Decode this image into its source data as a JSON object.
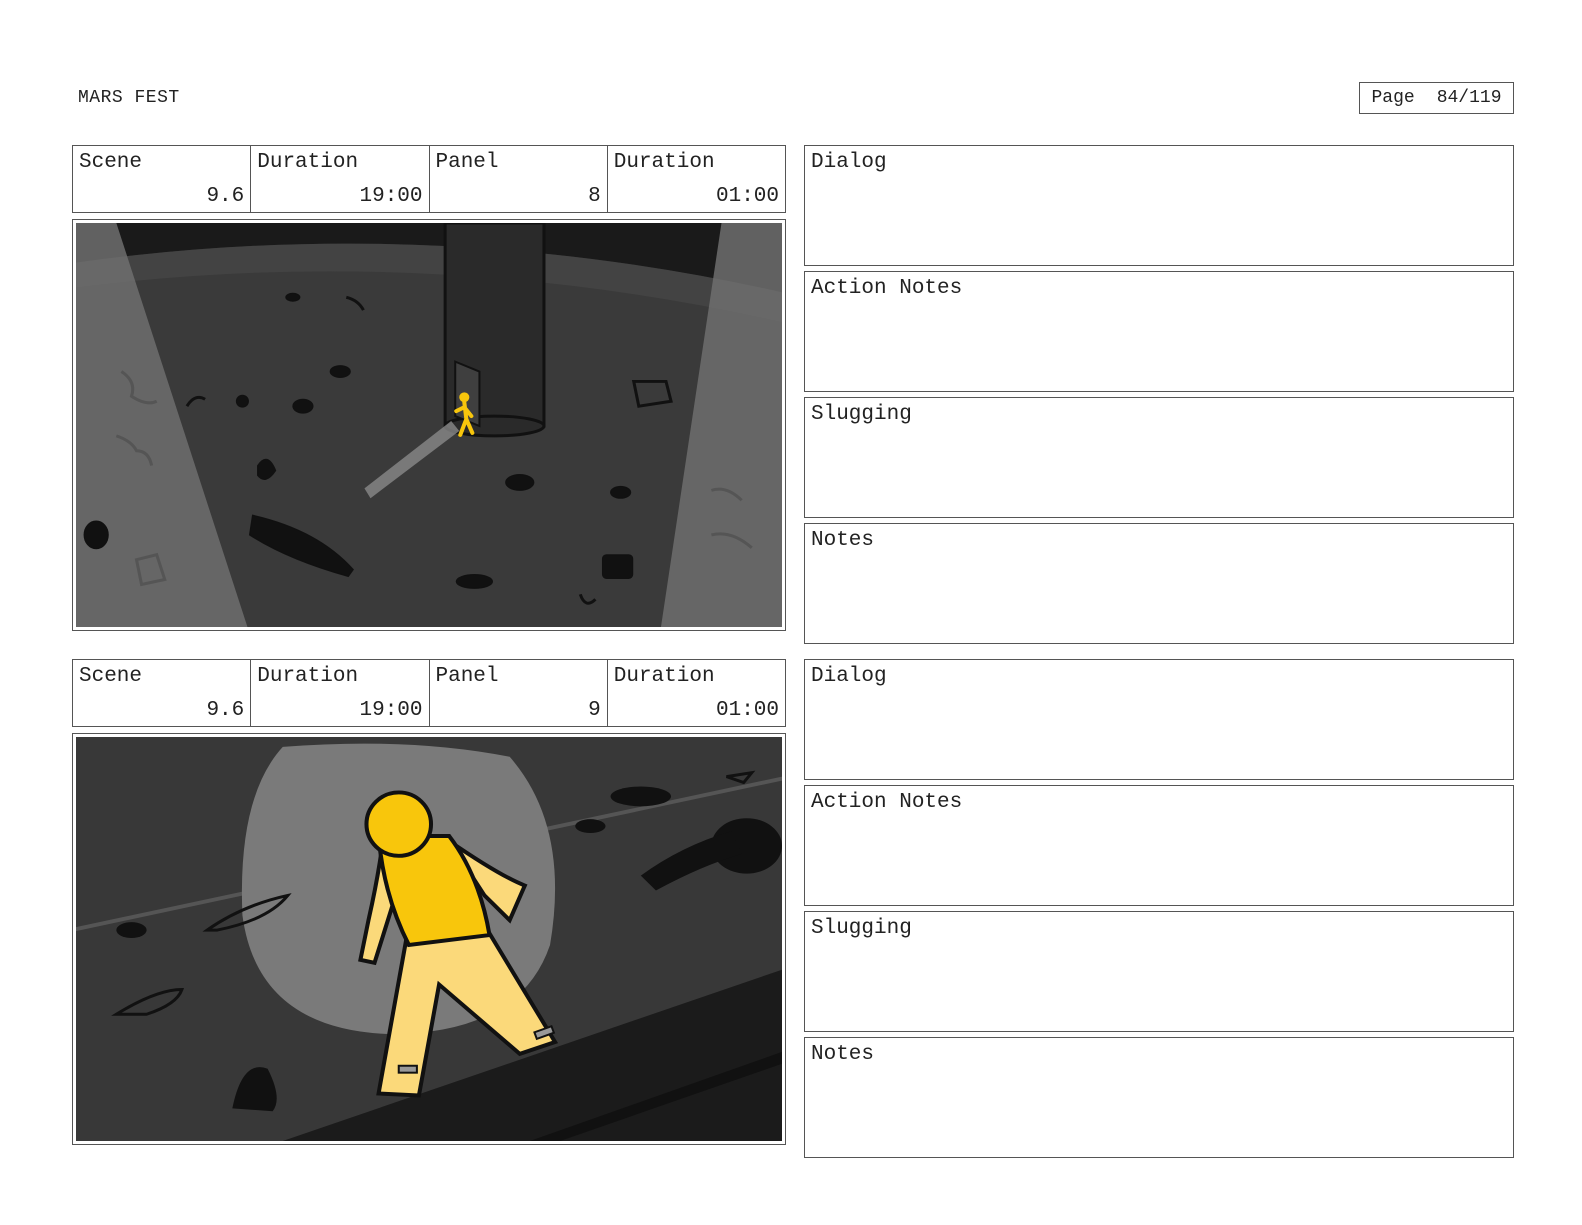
{
  "header": {
    "project_title": "MARS FEST",
    "page_label": "Page",
    "page_number": "84/119"
  },
  "labels": {
    "scene": "Scene",
    "duration": "Duration",
    "panel": "Panel"
  },
  "panels": [
    {
      "scene": "9.6",
      "scene_duration": "19:00",
      "panel": "8",
      "panel_duration": "01:00",
      "notes": {
        "dialog": "Dialog",
        "action_notes": "Action Notes",
        "slugging": "Slugging",
        "notes": "Notes"
      }
    },
    {
      "scene": "9.6",
      "scene_duration": "19:00",
      "panel": "9",
      "panel_duration": "01:00",
      "notes": {
        "dialog": "Dialog",
        "action_notes": "Action Notes",
        "slugging": "Slugging",
        "notes": "Notes"
      }
    }
  ],
  "colors": {
    "character_yellow": "#f8c60c",
    "skin_light": "#fbd97a",
    "floor_dark": "#3a3a3a",
    "spotlight": "#7a7a7a"
  }
}
